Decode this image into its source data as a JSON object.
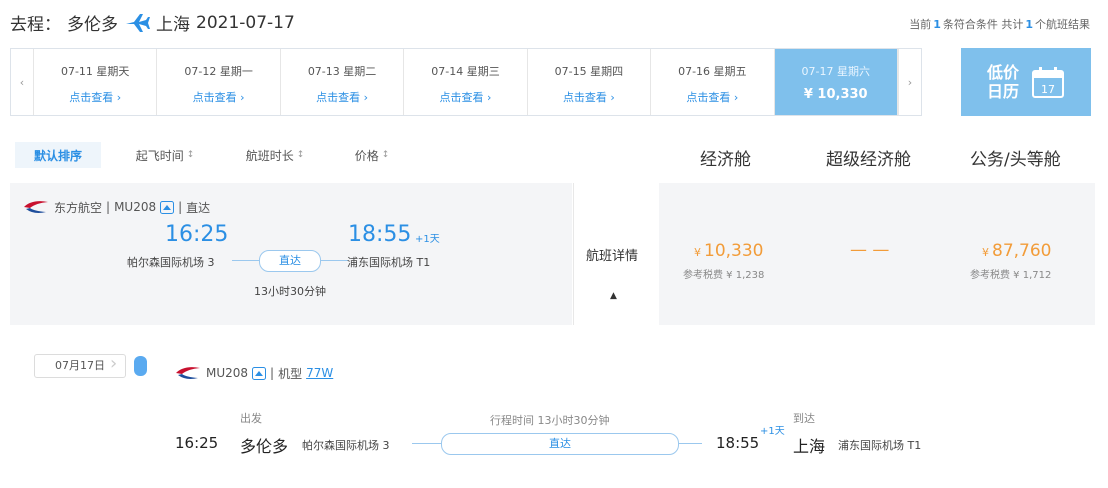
{
  "header": {
    "trip_prefix": "去程：",
    "origin": "多伦多",
    "destination": "上海",
    "date": "2021-07-17",
    "result_pre": "当前",
    "result_count": "1",
    "result_mid": "条符合条件 共计",
    "result_total": "1",
    "result_post": "个航班结果"
  },
  "datebar": {
    "dates": [
      {
        "date": "07-11 星期天",
        "link": "点击查看"
      },
      {
        "date": "07-12 星期一",
        "link": "点击查看"
      },
      {
        "date": "07-13 星期二",
        "link": "点击查看"
      },
      {
        "date": "07-14 星期三",
        "link": "点击查看"
      },
      {
        "date": "07-15 星期四",
        "link": "点击查看"
      },
      {
        "date": "07-16 星期五",
        "link": "点击查看"
      }
    ],
    "active": {
      "date": "07-17 星期六",
      "price": "¥ 10,330"
    },
    "prev_arrow": "‹",
    "next_arrow": "›",
    "calendar": {
      "line1": "低价",
      "line2": "日历",
      "day": "17"
    }
  },
  "sort_tabs": [
    {
      "label": "默认排序",
      "arrow": ""
    },
    {
      "label": "起飞时间",
      "arrow": "↕"
    },
    {
      "label": "航班时长",
      "arrow": "↕"
    },
    {
      "label": "价格",
      "arrow": "↕"
    }
  ],
  "cabins": [
    "经济舱",
    "超级经济舱",
    "公务/头等舱"
  ],
  "flight": {
    "airline": "东方航空",
    "flight_no": "MU208",
    "direct": "直达",
    "dep_time": "16:25",
    "arr_time": "18:55",
    "plus_day": "+1天",
    "dep_airport": "帕尔森国际机场 3",
    "arr_airport": "浦东国际机场 T1",
    "duration": "13小时30分钟",
    "detail_label": "航班详情",
    "fares": {
      "economy": {
        "currency": "¥",
        "price": "10,330",
        "tax": "参考税费 ¥ 1,238"
      },
      "premium": {
        "price": "— —"
      },
      "business": {
        "currency": "¥",
        "price": "87,760",
        "tax": "参考税费 ¥ 1,712"
      }
    }
  },
  "detail": {
    "date": "07月17日",
    "flight_no": "MU208",
    "aircraft_label": "机型",
    "aircraft_type": "77W",
    "depart_label": "出发",
    "arrive_label": "到达",
    "duration_label": "行程时间 13小时30分钟",
    "dep_time": "16:25",
    "dep_city": "多伦多",
    "dep_airport": "帕尔森国际机场 3",
    "direct": "直达",
    "arr_time": "18:55",
    "plus_day": "+1天",
    "arr_city": "上海",
    "arr_airport": "浦东国际机场 T1"
  },
  "colors": {
    "accent": "#2b8fe4",
    "active_tab": "#7fc0ec",
    "price": "#f29c39"
  }
}
